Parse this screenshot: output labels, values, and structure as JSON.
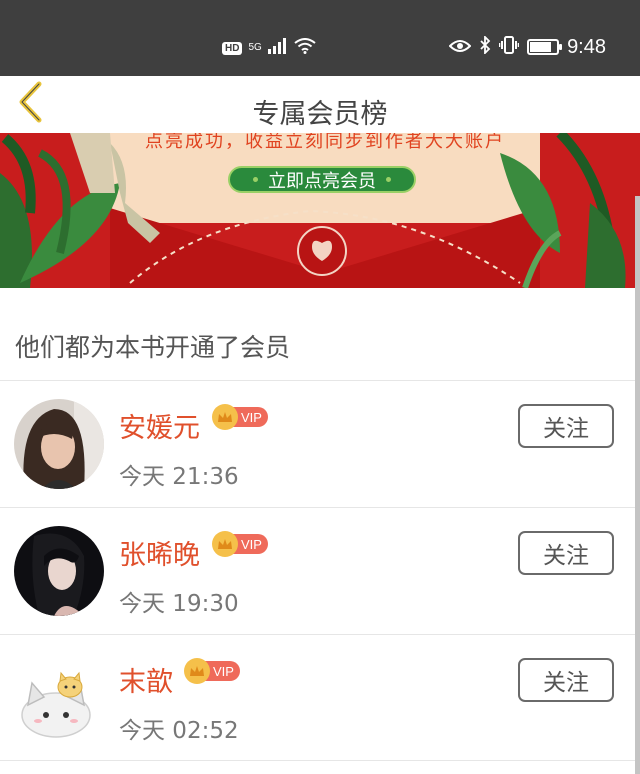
{
  "status_bar": {
    "hd": "HD",
    "network": "5G",
    "time": "9:48",
    "battery_level": 0.8,
    "icons": [
      "hd-icon",
      "signal-icon",
      "wifi-icon",
      "eye-icon",
      "bluetooth-icon",
      "vibrate-icon",
      "battery-icon"
    ]
  },
  "header": {
    "title": "专属会员榜",
    "back_icon": "chevron-left-icon",
    "back_color": "#e8c43c"
  },
  "banner": {
    "text": "点亮成功，收益立刻同步到作者大大账户",
    "button_label": "立即点亮会员",
    "bg_color": "#c81d1d",
    "button_color": "#2a8a3c"
  },
  "section": {
    "title": "他们都为本书开通了会员"
  },
  "members": [
    {
      "name": "安媛元",
      "vip": "VIP",
      "time": "今天 21:36",
      "follow_label": "关注"
    },
    {
      "name": "张晞晚",
      "vip": "VIP",
      "time": "今天 19:30",
      "follow_label": "关注"
    },
    {
      "name": "末歆",
      "vip": "VIP",
      "time": "今天 02:52",
      "follow_label": "关注"
    }
  ],
  "colors": {
    "name_color": "#e0502c",
    "vip_tag": "#ef6a5a",
    "crown": "#f5c04a"
  }
}
